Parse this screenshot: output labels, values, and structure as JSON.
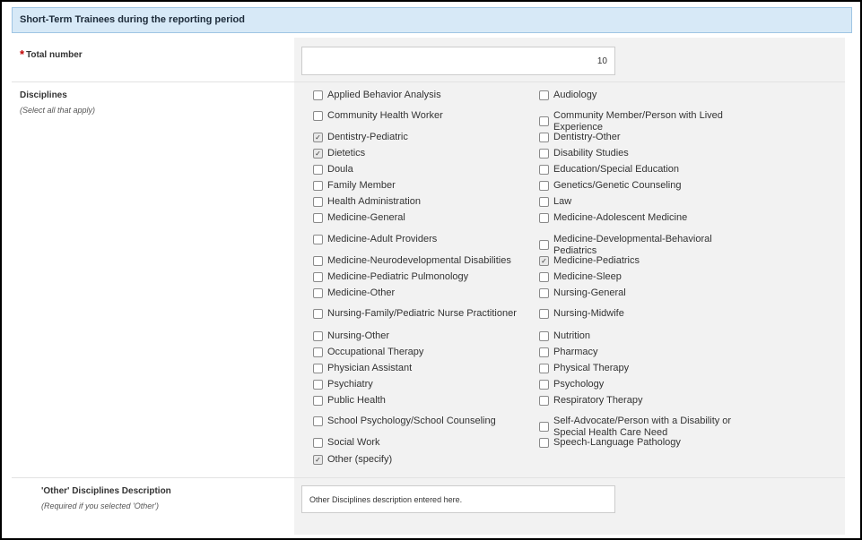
{
  "section": {
    "title": "Short-Term Trainees during the reporting period"
  },
  "total_number": {
    "label": "Total number",
    "value": "10"
  },
  "disciplines": {
    "label": "Disciplines",
    "hint": "(Select all that apply)",
    "check_glyph": "✓",
    "left_column": [
      {
        "label": "Applied Behavior Analysis",
        "checked": false
      },
      {
        "label": "Community Health Worker",
        "checked": false
      },
      {
        "label": "Dentistry-Pediatric",
        "checked": true
      },
      {
        "label": "Dietetics",
        "checked": true
      },
      {
        "label": "Doula",
        "checked": false
      },
      {
        "label": "Family Member",
        "checked": false
      },
      {
        "label": "Health Administration",
        "checked": false
      },
      {
        "label": "Medicine-General",
        "checked": false
      },
      {
        "label": "Medicine-Adult Providers",
        "checked": false
      },
      {
        "label": "Medicine-Neurodevelopmental Disabilities",
        "checked": false
      },
      {
        "label": "Medicine-Pediatric Pulmonology",
        "checked": false
      },
      {
        "label": "Medicine-Other",
        "checked": false
      },
      {
        "label": "Nursing-Family/Pediatric Nurse Practitioner",
        "checked": false
      },
      {
        "label": "Nursing-Other",
        "checked": false
      },
      {
        "label": "Occupational Therapy",
        "checked": false
      },
      {
        "label": "Physician Assistant",
        "checked": false
      },
      {
        "label": "Psychiatry",
        "checked": false
      },
      {
        "label": "Public Health",
        "checked": false
      },
      {
        "label": "School Psychology/School Counseling",
        "checked": false
      },
      {
        "label": "Social Work",
        "checked": false
      },
      {
        "label": "Other (specify)",
        "checked": true
      }
    ],
    "right_column": [
      {
        "label": "Audiology",
        "checked": false
      },
      {
        "label": "Community Member/Person with Lived Experience",
        "checked": false
      },
      {
        "label": "Dentistry-Other",
        "checked": false
      },
      {
        "label": "Disability Studies",
        "checked": false
      },
      {
        "label": "Education/Special Education",
        "checked": false
      },
      {
        "label": "Genetics/Genetic Counseling",
        "checked": false
      },
      {
        "label": "Law",
        "checked": false
      },
      {
        "label": "Medicine-Adolescent Medicine",
        "checked": false
      },
      {
        "label": "Medicine-Developmental-Behavioral Pediatrics",
        "checked": false
      },
      {
        "label": "Medicine-Pediatrics",
        "checked": true
      },
      {
        "label": "Medicine-Sleep",
        "checked": false
      },
      {
        "label": "Nursing-General",
        "checked": false
      },
      {
        "label": "Nursing-Midwife",
        "checked": false
      },
      {
        "label": "Nutrition",
        "checked": false
      },
      {
        "label": "Pharmacy",
        "checked": false
      },
      {
        "label": "Physical Therapy",
        "checked": false
      },
      {
        "label": "Psychology",
        "checked": false
      },
      {
        "label": "Respiratory Therapy",
        "checked": false
      },
      {
        "label": "Self-Advocate/Person with a Disability or Special Health Care Need",
        "checked": false
      },
      {
        "label": "Speech-Language Pathology",
        "checked": false
      }
    ]
  },
  "other_description": {
    "label": "'Other' Disciplines Description",
    "hint": "(Required if you selected 'Other')",
    "value": "Other Disciplines description entered here."
  }
}
